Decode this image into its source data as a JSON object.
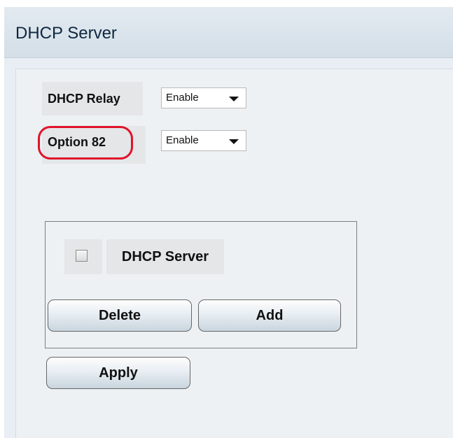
{
  "header": {
    "title": "DHCP Server"
  },
  "settings": {
    "dhcp_relay": {
      "label": "DHCP Relay",
      "value": "Enable"
    },
    "option82": {
      "label": "Option 82",
      "value": "Enable",
      "highlight_color": "#e0132a"
    }
  },
  "server_table": {
    "header_label": "DHCP Server",
    "select_all_checked": false
  },
  "buttons": {
    "delete": "Delete",
    "add": "Add",
    "apply": "Apply"
  },
  "colors": {
    "header_bg": "#d3dee7",
    "content_bg": "#edf1f4",
    "title_text": "#0f2740"
  }
}
